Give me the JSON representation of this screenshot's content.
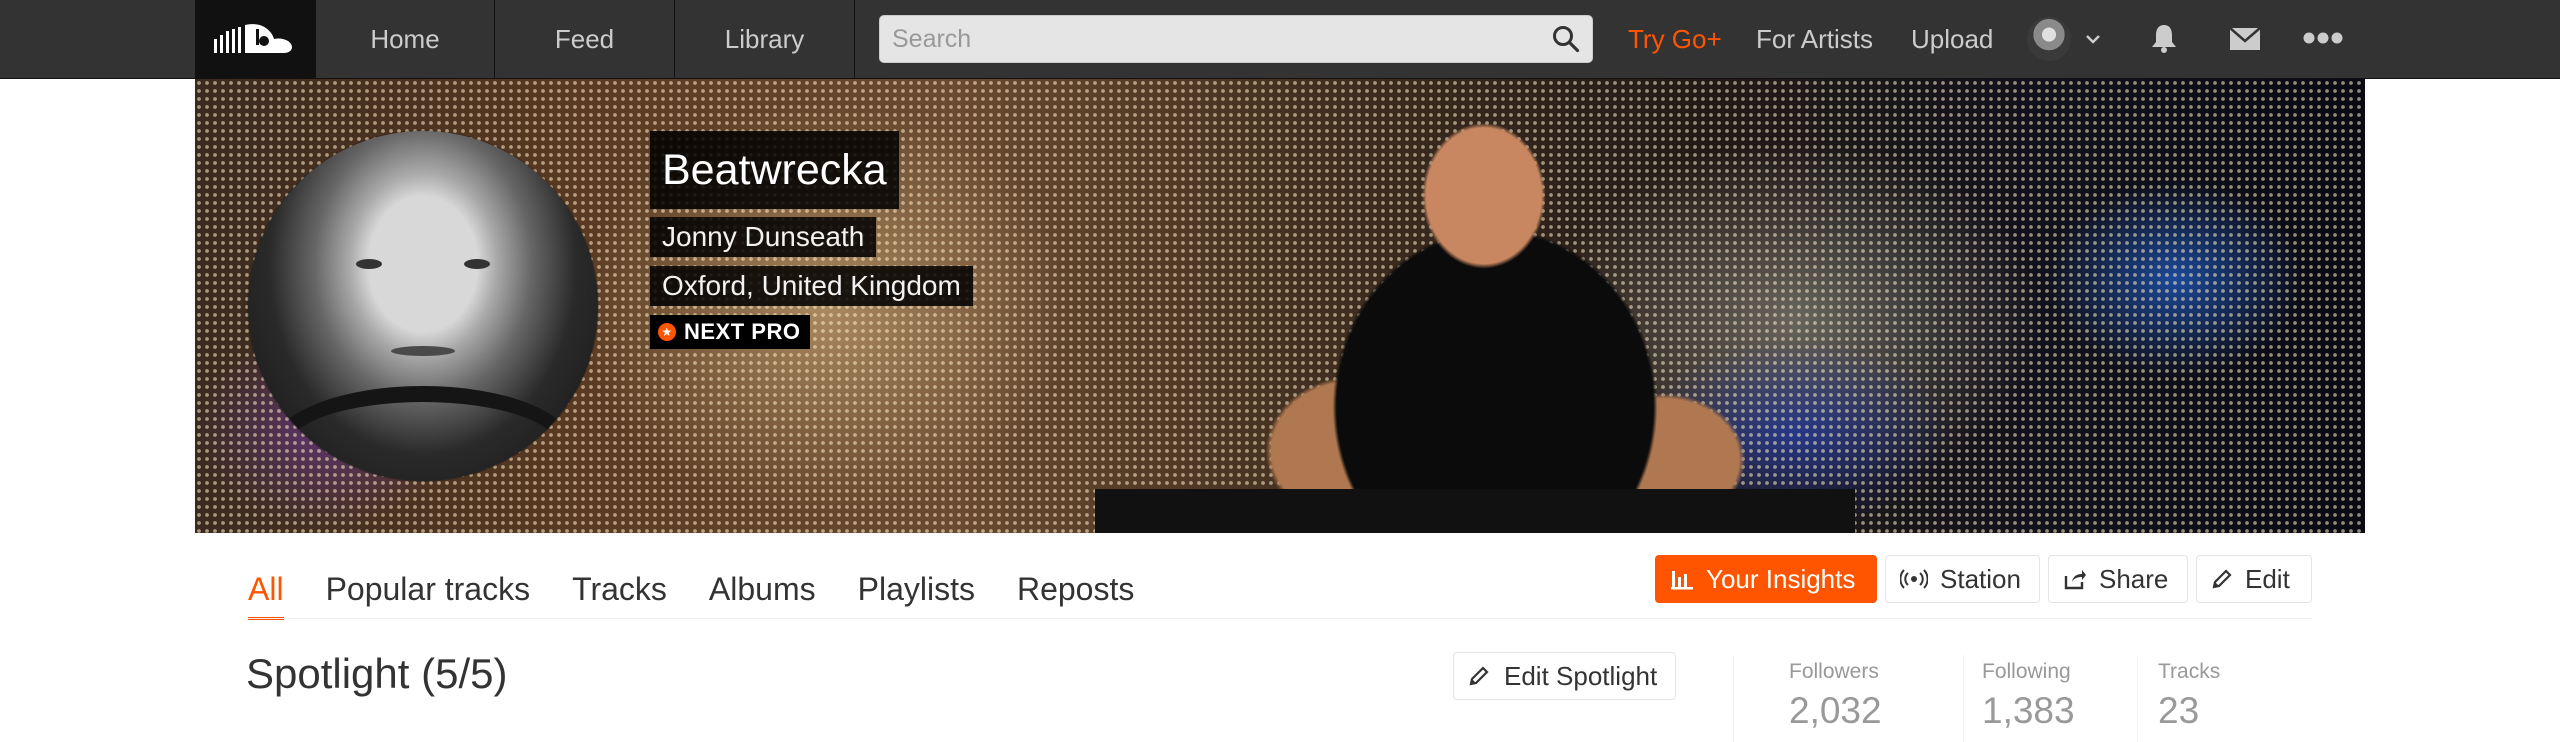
{
  "nav": {
    "tabs": [
      "Home",
      "Feed",
      "Library"
    ],
    "search_placeholder": "Search",
    "try_go": "Try Go+",
    "for_artists": "For Artists",
    "upload": "Upload"
  },
  "profile": {
    "name": "Beatwrecka",
    "real_name": "Jonny Dunseath",
    "location": "Oxford, United Kingdom",
    "badge": "NEXT PRO"
  },
  "tabs": [
    "All",
    "Popular tracks",
    "Tracks",
    "Albums",
    "Playlists",
    "Reposts"
  ],
  "active_tab": "All",
  "actions": {
    "insights": "Your Insights",
    "station": "Station",
    "share": "Share",
    "edit": "Edit"
  },
  "spotlight": {
    "title": "Spotlight (5/5)",
    "edit_label": "Edit Spotlight"
  },
  "stats": [
    {
      "label": "Followers",
      "value": "2,032"
    },
    {
      "label": "Following",
      "value": "1,383"
    },
    {
      "label": "Tracks",
      "value": "23"
    }
  ],
  "colors": {
    "accent": "#ff5500",
    "topbar": "#333333"
  }
}
